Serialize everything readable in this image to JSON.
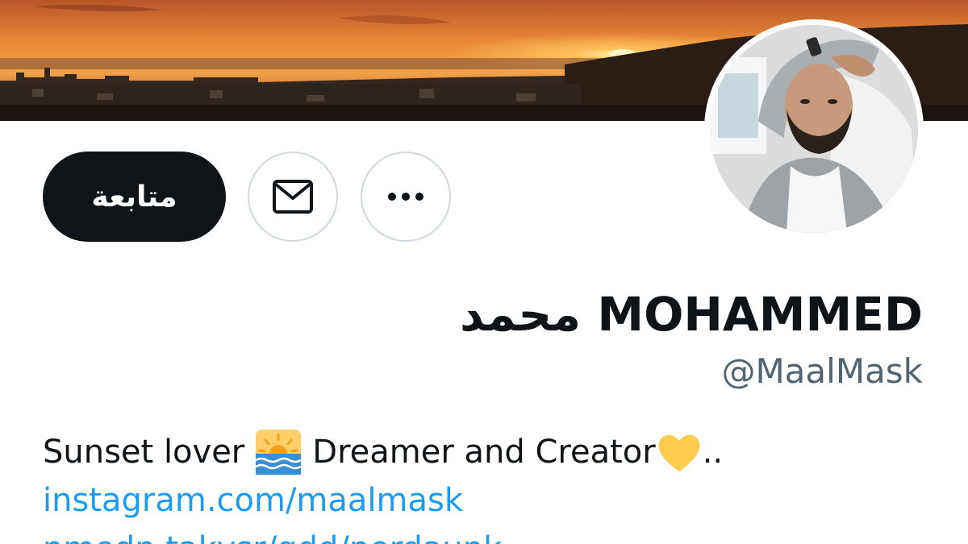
{
  "profile": {
    "display_name": "محمد MOHAMMED",
    "handle": "@MaalMask",
    "follow_label": "متابعة"
  },
  "bio": {
    "text_before_emoji": "Sunset lover",
    "text_after_emoji": "Dreamer and Creator",
    "trailing": "..",
    "link": "instagram.com/maalmask",
    "partial_link": "nmedn.takvsr/qdd/nerdaunk"
  },
  "icons": {
    "message": "envelope-icon",
    "more": "ellipsis-icon",
    "sunrise": "sunrise-emoji-icon",
    "heart": "yellow-heart-emoji-icon"
  },
  "colors": {
    "follow_bg": "#0f1419",
    "link": "#1d9bf0",
    "handle": "#536471",
    "border": "#cfd9de"
  }
}
